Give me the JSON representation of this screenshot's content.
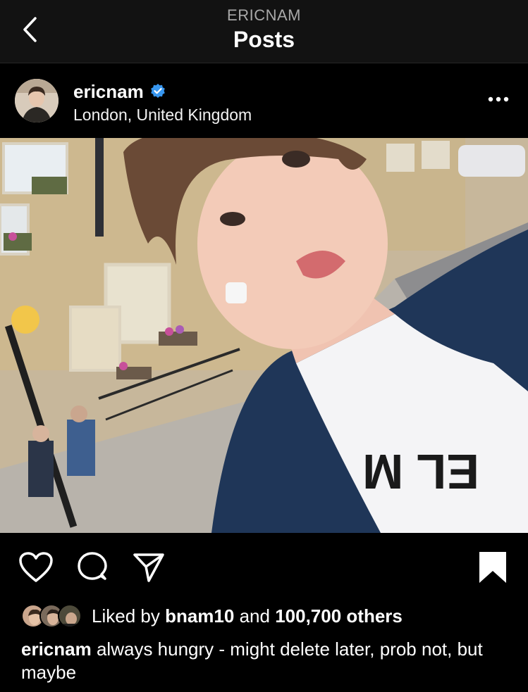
{
  "nav": {
    "subtitle": "ERICNAM",
    "title": "Posts"
  },
  "post": {
    "username": "ericnam",
    "location": "London, United Kingdom",
    "verified": true,
    "likes": {
      "prefix": "Liked by",
      "user": "bnam10",
      "joiner": "and",
      "others": "100,700 others"
    },
    "caption": {
      "user": "ericnam",
      "text": "always hungry - might delete later, prob not, but maybe"
    }
  },
  "icons": {
    "back": "chevron-left-icon",
    "verified": "verified-badge-icon",
    "more": "more-horizontal-icon",
    "like": "heart-icon",
    "comment": "comment-icon",
    "share": "send-icon",
    "save": "bookmark-icon"
  },
  "colors": {
    "background": "#000000",
    "navbar": "#121212",
    "verified": "#3897f0",
    "subtitle": "#a8a8a8"
  }
}
